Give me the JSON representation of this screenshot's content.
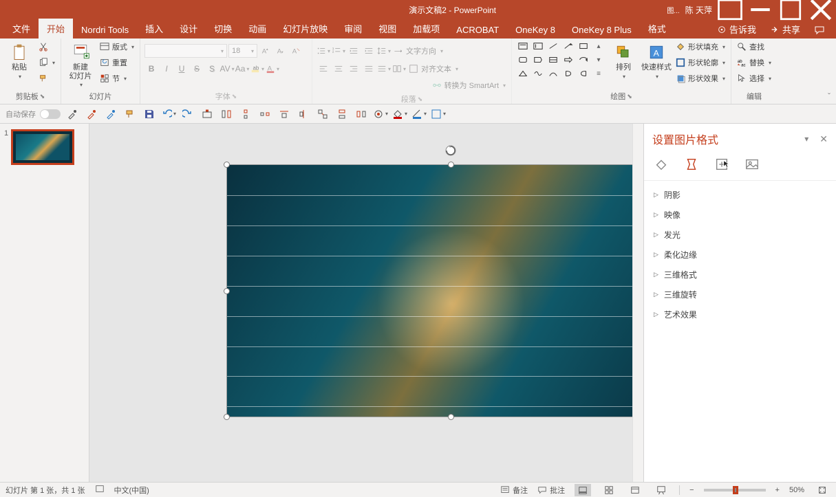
{
  "titlebar": {
    "doc": "演示文稿2",
    "sep": "  -  ",
    "app": "PowerPoint",
    "user": "陈 天萍",
    "pic_icon": "图..."
  },
  "tabs": {
    "file": "文件",
    "home": "开始",
    "nordri": "Nordri Tools",
    "insert": "插入",
    "design": "设计",
    "transition": "切换",
    "animation": "动画",
    "slideshow": "幻灯片放映",
    "review": "审阅",
    "view": "视图",
    "addin": "加载项",
    "acrobat": "ACROBAT",
    "onekey": "OneKey 8",
    "onekeyplus": "OneKey 8 Plus",
    "format": "格式",
    "tellme": "告诉我",
    "share": "共享"
  },
  "ribbon": {
    "clipboard": {
      "paste": "粘贴",
      "label": "剪贴板"
    },
    "slides": {
      "new": "新建\n幻灯片",
      "layout": "版式",
      "reset": "重置",
      "section": "节",
      "label": "幻灯片"
    },
    "font": {
      "size": "18",
      "label": "字体"
    },
    "para": {
      "dir": "文字方向",
      "align": "对齐文本",
      "smartart": "转换为 SmartArt",
      "label": "段落"
    },
    "draw": {
      "arrange": "排列",
      "quick": "快速样式",
      "fill": "形状填充",
      "outline": "形状轮廓",
      "effects": "形状效果",
      "label": "绘图"
    },
    "edit": {
      "find": "查找",
      "replace": "替换",
      "select": "选择",
      "label": "编辑"
    }
  },
  "qat": {
    "autosave": "自动保存"
  },
  "pane": {
    "title": "设置图片格式",
    "items": [
      "阴影",
      "映像",
      "发光",
      "柔化边缘",
      "三维格式",
      "三维旋转",
      "艺术效果"
    ]
  },
  "status": {
    "slide": "幻灯片 第 1 张，共 1 张",
    "lang": "中文(中国)",
    "notes": "备注",
    "comments": "批注",
    "zoom": "50%"
  },
  "thumb": {
    "num": "1"
  }
}
